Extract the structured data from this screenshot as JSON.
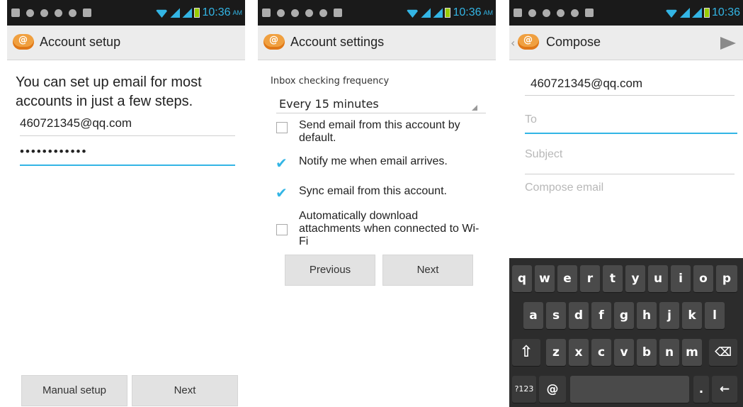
{
  "status": {
    "time": "10:36",
    "ampm": "AM"
  },
  "screen1": {
    "title": "Account setup",
    "intro": "You can set up email for most accounts in just a few steps.",
    "email_value": "460721345@qq.com",
    "password_value": "••••••••••••",
    "manual_button": "Manual setup",
    "next_button": "Next"
  },
  "screen2": {
    "title": "Account settings",
    "frequency_label": "Inbox checking frequency",
    "frequency_value": "Every 15 minutes",
    "options": [
      {
        "label": "Send email from this account by default.",
        "checked": false
      },
      {
        "label": "Notify me when email arrives.",
        "checked": true
      },
      {
        "label": "Sync email from this account.",
        "checked": true
      },
      {
        "label": "Automatically download attachments when connected to Wi-Fi",
        "checked": false
      }
    ],
    "previous_button": "Previous",
    "next_button": "Next"
  },
  "screen3": {
    "title": "Compose",
    "from_value": "460721345@qq.com",
    "to_placeholder": "To",
    "subject_placeholder": "Subject",
    "body_placeholder": "Compose email",
    "keyboard": {
      "row1": [
        "q",
        "w",
        "e",
        "r",
        "t",
        "y",
        "u",
        "i",
        "o",
        "p"
      ],
      "row2": [
        "a",
        "s",
        "d",
        "f",
        "g",
        "h",
        "j",
        "k",
        "l"
      ],
      "row3": [
        "z",
        "x",
        "c",
        "v",
        "b",
        "n",
        "m"
      ],
      "symbols_key": "?123",
      "at_key": "@",
      "period_key": "."
    }
  },
  "colors": {
    "accent": "#33b5e5",
    "statusbar": "#1a1a1a",
    "keyboard": "#2c2c2c"
  },
  "icons": [
    "email-app-icon",
    "wifi-icon",
    "signal-icon",
    "battery-icon",
    "send-icon",
    "back-icon",
    "shift-icon",
    "delete-icon",
    "enter-icon"
  ]
}
